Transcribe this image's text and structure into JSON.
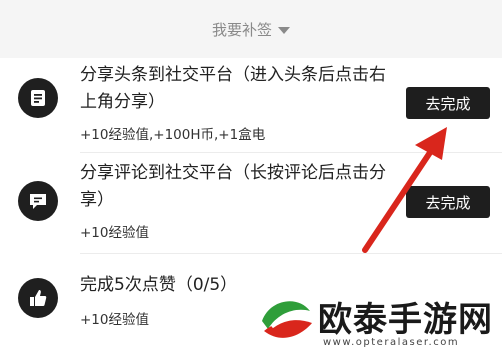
{
  "header": {
    "label": "我要补签",
    "icon": "caret-down-icon"
  },
  "tasks": [
    {
      "title": "分享头条到社交平台（进入头条后点击右上角分享）",
      "reward": "+10经验值,+100H币,+1盒电",
      "button": "去完成",
      "icon": "document-icon"
    },
    {
      "title": "分享评论到社交平台（长按评论后点击分享）",
      "reward": "+10经验值",
      "button": "去完成",
      "icon": "comment-icon"
    },
    {
      "title": "完成5次点赞（0/5）",
      "reward": "+10经验值",
      "icon": "thumbs-up-icon"
    }
  ],
  "watermark": {
    "title": "欧泰手游网",
    "url": "www.opteralaser.com",
    "accent": "#d9261c"
  },
  "colors": {
    "button_bg": "#1e1e1e",
    "arrow": "#d9261c",
    "header_bg": "#f5f5f5"
  }
}
